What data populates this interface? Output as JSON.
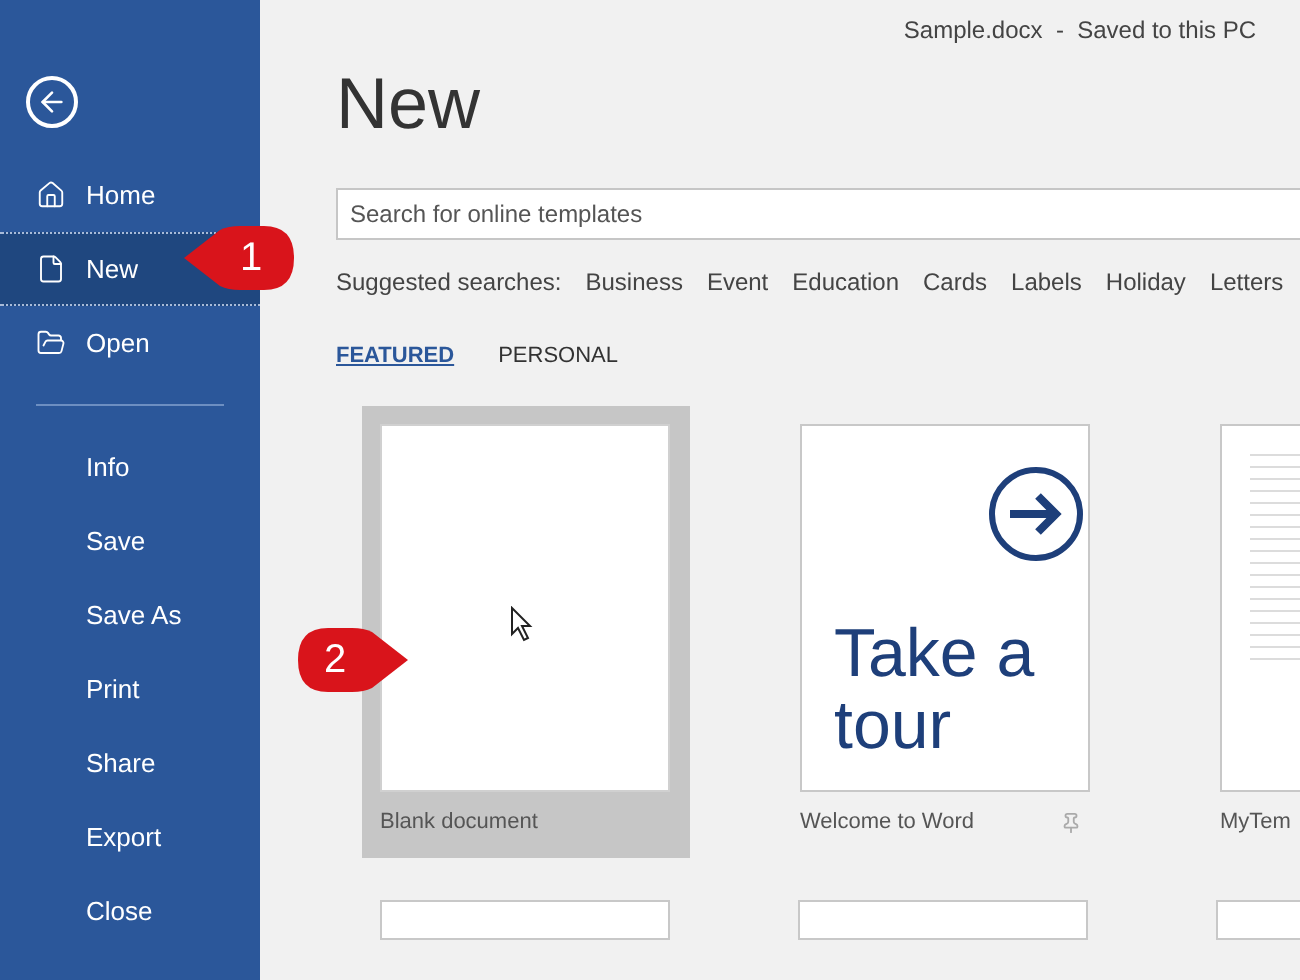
{
  "window": {
    "title": "Sample.docx  -  Saved to this PC"
  },
  "sidebar": {
    "sections": [
      {
        "items": [
          {
            "label": "Home",
            "selected": false
          },
          {
            "label": "New",
            "selected": true
          },
          {
            "label": "Open",
            "selected": false
          }
        ]
      },
      {
        "items": [
          {
            "label": "Info",
            "selected": false
          },
          {
            "label": "Save",
            "selected": false
          },
          {
            "label": "Save As",
            "selected": false
          },
          {
            "label": "Print",
            "selected": false
          },
          {
            "label": "Share",
            "selected": false
          },
          {
            "label": "Export",
            "selected": false
          },
          {
            "label": "Close",
            "selected": false
          }
        ]
      }
    ]
  },
  "heading": "New",
  "search": {
    "placeholder": "Search for online templates"
  },
  "suggested": {
    "label": "Suggested searches:",
    "items": [
      "Business",
      "Event",
      "Education",
      "Cards",
      "Labels",
      "Holiday",
      "Letters"
    ]
  },
  "tabs": [
    {
      "label": "FEATURED",
      "selected": true
    },
    {
      "label": "PERSONAL",
      "selected": false
    }
  ],
  "templates": [
    {
      "kind": "blank",
      "label": "Blank document",
      "selected": true,
      "pinned": false
    },
    {
      "kind": "tour",
      "label": "Welcome to Word",
      "selected": false,
      "pinned": true,
      "tour_text": "Take a tour"
    },
    {
      "kind": "document",
      "label": "MyTem",
      "selected": false,
      "pinned": false
    }
  ],
  "callouts": [
    {
      "label": "1"
    },
    {
      "label": "2"
    }
  ]
}
